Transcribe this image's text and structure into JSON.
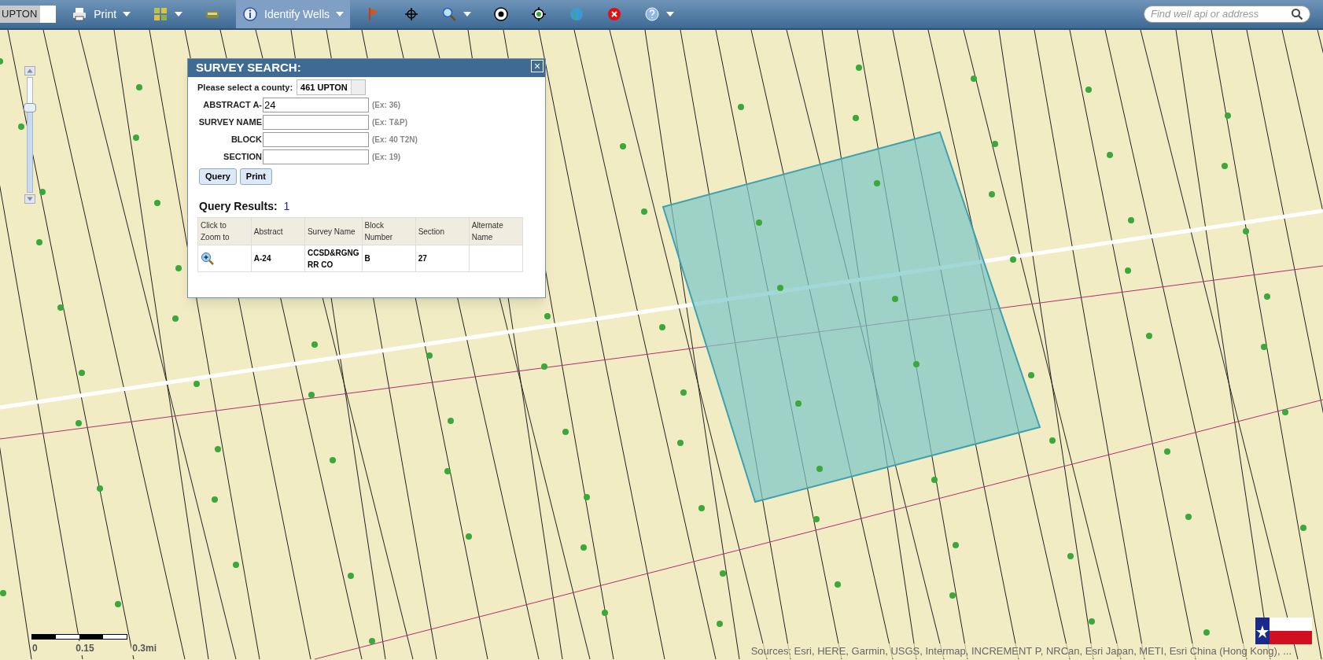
{
  "toolbar": {
    "county": "UPTON",
    "tools": [
      {
        "kind": "print",
        "label": "Print",
        "dropdown": true,
        "selected": false
      },
      {
        "kind": "layers",
        "dropdown": true,
        "selected": false
      },
      {
        "kind": "ruler",
        "dropdown": false,
        "selected": false
      },
      {
        "kind": "identify",
        "label": "Identify Wells",
        "dropdown": true,
        "selected": true
      },
      {
        "kind": "flag",
        "dropdown": false,
        "selected": false
      },
      {
        "kind": "crosshair",
        "dropdown": false,
        "selected": false
      },
      {
        "kind": "zoom",
        "dropdown": true,
        "selected": false
      },
      {
        "kind": "target",
        "dropdown": false,
        "selected": false
      },
      {
        "kind": "locate",
        "dropdown": false,
        "selected": false
      },
      {
        "kind": "globe",
        "dropdown": false,
        "selected": false
      },
      {
        "kind": "clear",
        "dropdown": false,
        "selected": false
      },
      {
        "kind": "help",
        "dropdown": true,
        "selected": false
      }
    ],
    "search": {
      "placeholder": "Find well api or address"
    }
  },
  "zoom_slider": {
    "level": 0.74
  },
  "dialog": {
    "title": "SURVEY SEARCH:",
    "close": "×",
    "county_label": "Please select a county:",
    "county_value": "461 UPTON",
    "fields": [
      {
        "label": "ABSTRACT A-",
        "value": "24",
        "hint": "(Ex: 36)"
      },
      {
        "label": "SURVEY NAME",
        "hint": "(Ex: T&P)"
      },
      {
        "label": "BLOCK",
        "hint": "(Ex: 40 T2N)"
      },
      {
        "label": "SECTION",
        "hint": "(Ex: 19)"
      }
    ],
    "buttons": [
      "Query",
      "Print"
    ],
    "results_label": "Query Results:",
    "results_count": "1",
    "table": {
      "columns": [
        "Click to Zoom to",
        "Abstract",
        "Survey Name",
        "Block Number",
        "Section",
        "Alternate Name"
      ],
      "rows": [
        {
          "abstract": "A-24",
          "survey_name": "CCSD&RGNG RR CO",
          "block_number": "B",
          "section": "27"
        }
      ]
    }
  },
  "scale_bar": {
    "ticks": [
      "0",
      "0.15",
      "0.3mi"
    ]
  },
  "attribution": "Sources: Esri, HERE, Garmin, USGS, Intermap, INCREMENT P, NRCan, Esri Japan, METI, Esri China (Hong Kong), ..."
}
